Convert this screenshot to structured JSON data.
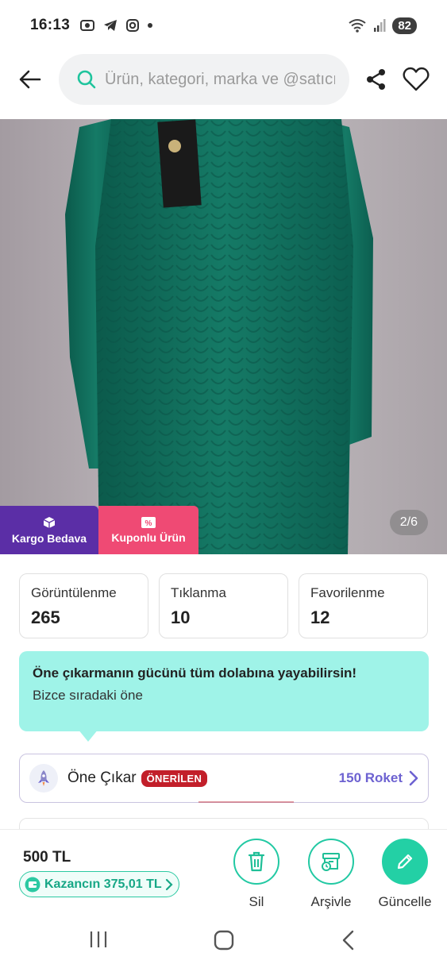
{
  "status_bar": {
    "time": "16:13",
    "battery": "82"
  },
  "header": {
    "search_placeholder": "Ürün, kategori, marka ve @satıcı ara"
  },
  "product_image": {
    "badges": [
      {
        "label": "Kargo Bedava",
        "icon": "box-icon",
        "color": "#5b2ea6"
      },
      {
        "label": "Kuponlu Ürün",
        "icon": "coupon-icon",
        "color": "#ef4a74"
      }
    ],
    "counter": "2/6"
  },
  "stats": [
    {
      "label": "Görüntülenme",
      "value": "265"
    },
    {
      "label": "Tıklanma",
      "value": "10"
    },
    {
      "label": "Favorilenme",
      "value": "12"
    }
  ],
  "promo": {
    "title": "Öne çıkarmanın gücünü tüm dolabına yayabilirsin!",
    "subtitle": "Bizce sıradaki öne"
  },
  "boost": {
    "title": "Öne Çıkar",
    "tag": "ÖNERİLEN",
    "price": "150 Roket"
  },
  "bottom_bar": {
    "price": "500 TL",
    "earnings": "Kazancın 375,01 TL",
    "actions": [
      {
        "label": "Sil",
        "icon": "trash-icon"
      },
      {
        "label": "Arşivle",
        "icon": "archive-icon"
      },
      {
        "label": "Güncelle",
        "icon": "pencil-icon"
      }
    ]
  },
  "colors": {
    "accent": "#23d0a5",
    "promo_bg": "#9ff3e8",
    "tag_red": "#c21f2a",
    "rocket_price": "#6d62d1"
  }
}
